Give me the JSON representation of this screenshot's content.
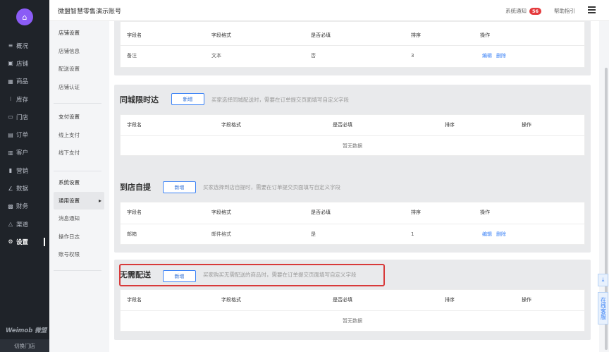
{
  "header": {
    "title": "微盟智慧零售演示账号",
    "notice_label": "系统通知",
    "notice_count": "56",
    "help_label": "帮助指引"
  },
  "sidebar": {
    "items": [
      {
        "icon": "≡",
        "label": "概况"
      },
      {
        "icon": "▣",
        "label": "店铺"
      },
      {
        "icon": "▦",
        "label": "商品"
      },
      {
        "icon": "⁝",
        "label": "库存"
      },
      {
        "icon": "▭",
        "label": "门店"
      },
      {
        "icon": "▤",
        "label": "订单"
      },
      {
        "icon": "▥",
        "label": "客户"
      },
      {
        "icon": "▮",
        "label": "营销"
      },
      {
        "icon": "∠",
        "label": "数据"
      },
      {
        "icon": "▩",
        "label": "财务"
      },
      {
        "icon": "△",
        "label": "渠道"
      },
      {
        "icon": "⚙",
        "label": "设置"
      }
    ],
    "brand": "Weimob 微盟",
    "switch_store": "切换门店"
  },
  "subnav": {
    "store": [
      "店铺设置",
      "店铺信息",
      "配送设置",
      "店铺认证"
    ],
    "pay": [
      "支付设置",
      "线上支付",
      "线下支付"
    ],
    "system": [
      "系统设置",
      "通用设置",
      "消息通知",
      "操作日志",
      "账号权限"
    ]
  },
  "table_headers": {
    "name": "字段名",
    "format": "字段格式",
    "required": "是否必填",
    "order": "排序",
    "action": "操作"
  },
  "sections": {
    "top": {
      "rows": [
        {
          "name": "备注",
          "format": "文本",
          "required": "否",
          "order": "3",
          "edit": "编辑",
          "delete": "删除"
        }
      ]
    },
    "city": {
      "title": "同城限时达",
      "add": "新增",
      "desc": "买家选择同城配送时，需要在订单提交页面填写自定义字段",
      "empty": "暂无数据"
    },
    "pickup": {
      "title": "到店自提",
      "add": "新增",
      "desc": "买家选择到店自提时，需要在订单提交页面填写自定义字段",
      "rows": [
        {
          "name": "邮箱",
          "format": "邮件格式",
          "required": "是",
          "order": "1",
          "edit": "编辑",
          "delete": "删除"
        }
      ]
    },
    "none": {
      "title": "无需配送",
      "add": "新增",
      "desc": "买家购买无需配送的商品时，需要在订单提交页面填写自定义字段",
      "empty": "暂无数据"
    }
  },
  "float": {
    "download_icon": "⤓",
    "service_label": "在线客服"
  }
}
